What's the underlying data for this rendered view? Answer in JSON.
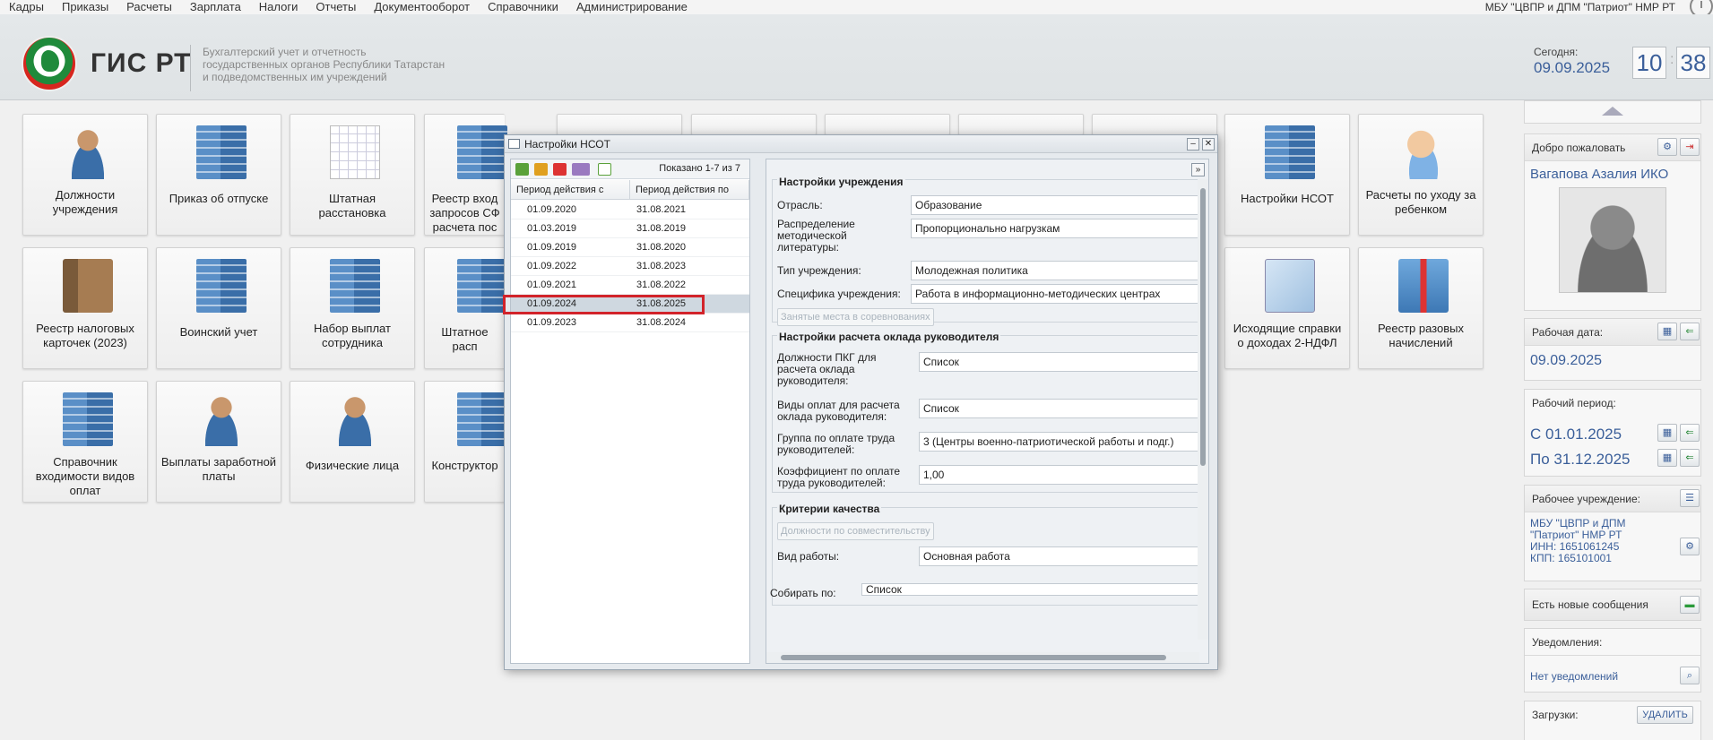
{
  "menu": [
    "Кадры",
    "Приказы",
    "Расчеты",
    "Зарплата",
    "Налоги",
    "Отчеты",
    "Документооборот",
    "Справочники",
    "Администрирование"
  ],
  "org_name": "МБУ \"ЦВПР и ДПМ \"Патриот\" НМР РТ",
  "header": {
    "title": "ГИС РТ",
    "subtitle_1": "Бухгалтерский учет и отчетность",
    "subtitle_2": "государственных органов Республики Татарстан",
    "subtitle_3": "и подведомственных им учреждений",
    "today_label": "Сегодня:",
    "today_value": "09.09.2025",
    "hours": "10",
    "minutes": "38"
  },
  "tiles": {
    "t1": "Должности учреждения",
    "t2": "Приказ об отпуске",
    "t3": "Штатная расстановка",
    "t4": "Реестр вход запросов СФ расчета пос",
    "t5": "Настройки НСОТ",
    "t6": "Расчеты по уходу за ребенком",
    "t7": "Реестр налоговых карточек (2023)",
    "t8": "Воинский учет",
    "t9": "Набор выплат сотрудника",
    "t10": "Штатное расп",
    "t11": "Исходящие справки о доходах 2-НДФЛ",
    "t12": "Реестр разовых начислений",
    "t13": "Справочник входимости видов оплат",
    "t14": "Выплаты заработной платы",
    "t15": "Физические лица",
    "t16": "Конструктор"
  },
  "right_panel": {
    "welcome": "Добро пожаловать",
    "user": "Вагапова Азалия ИКО",
    "work_date_label": "Рабочая дата:",
    "work_date": "09.09.2025",
    "period_label": "Рабочий период:",
    "period_from": "С  01.01.2025",
    "period_to": "По 31.12.2025",
    "institution_label": "Рабочее учреждение:",
    "inst_1": "МБУ \"ЦВПР и ДПМ",
    "inst_2": "\"Патриот\" НМР РТ",
    "inst_3": "ИНН: 1651061245",
    "inst_4": "КПП: 165101001",
    "messages": "Есть новые сообщения",
    "notifications_label": "Уведомления:",
    "notifications_value": "Нет уведомлений",
    "downloads_label": "Загрузки:",
    "delete_btn": "УДАЛИТЬ"
  },
  "dialog": {
    "title": "Настройки НСОТ",
    "shown": "Показано 1-7 из 7",
    "col_from": "Период действия с",
    "col_to": "Период действия по",
    "rows": [
      [
        "01.09.2020",
        "31.08.2021"
      ],
      [
        "01.03.2019",
        "31.08.2019"
      ],
      [
        "01.09.2019",
        "31.08.2020"
      ],
      [
        "01.09.2022",
        "31.08.2023"
      ],
      [
        "01.09.2021",
        "31.08.2022"
      ],
      [
        "01.09.2024",
        "31.08.2025"
      ],
      [
        "01.09.2023",
        "31.08.2024"
      ]
    ],
    "s1_title": "Настройки учреждения",
    "branch_label": "Отрасль:",
    "branch_value": "Образование",
    "distr_l1": "Распределение",
    "distr_l2": "методической",
    "distr_l3": "литературы:",
    "distr_value": "Пропорционально нагрузкам",
    "type_label": "Тип учреждения:",
    "type_value": "Молодежная политика",
    "spec_label": "Специфика учреждения:",
    "spec_value": "Работа в информационно-методических центрах",
    "places_btn": "Занятые места в соревнованиях",
    "s2_title": "Настройки расчета оклада руководителя",
    "pkg_l1": "Должности ПКГ для",
    "pkg_l2": "расчета оклада",
    "pkg_l3": "руководителя:",
    "pkg_value": "Список",
    "pay_l1": "Виды оплат для расчета",
    "pay_l2": "оклада руководителя:",
    "pay_value": "Список",
    "grp_l1": "Группа по оплате труда",
    "grp_l2": "руководителей:",
    "grp_value": "3 (Центры военно-патриотической работы и подг.)",
    "coef_l1": "Коэффициент по оплате",
    "coef_l2": "труда руководителей:",
    "coef_value": "1,00",
    "s3_title": "Критерии качества",
    "combo_btn": "Должности по совместительству",
    "work_label": "Вид работы:",
    "work_value": "Основная работа",
    "collect_label": "Собирать по:",
    "collect_value": "Список"
  }
}
